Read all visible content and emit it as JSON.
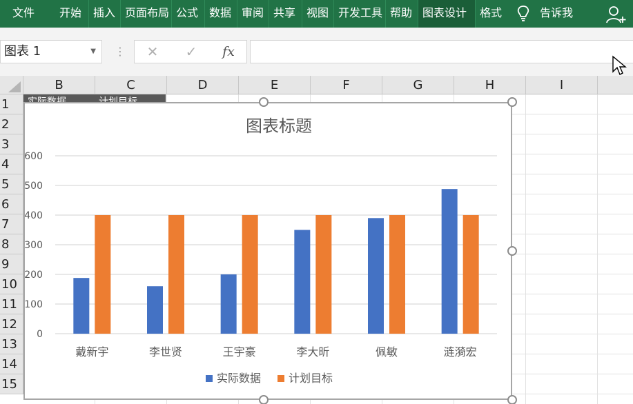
{
  "ribbon": {
    "tabs": [
      {
        "label": "文件",
        "active": false
      },
      {
        "label": "开始",
        "active": false
      },
      {
        "label": "插入",
        "active": false
      },
      {
        "label": "页面布局",
        "active": false
      },
      {
        "label": "公式",
        "active": false
      },
      {
        "label": "数据",
        "active": false
      },
      {
        "label": "审阅",
        "active": false
      },
      {
        "label": "共享",
        "active": false
      },
      {
        "label": "视图",
        "active": false
      },
      {
        "label": "开发工具",
        "active": false
      },
      {
        "label": "帮助",
        "active": false
      },
      {
        "label": "图表设计",
        "active": true
      },
      {
        "label": "格式",
        "active": false
      }
    ],
    "tell_me": "告诉我",
    "share_icon": "person-add-icon",
    "colors": {
      "ribbon": "#217346",
      "active_tab": "#1a5e38"
    }
  },
  "formula_bar": {
    "name_box": "图表 1",
    "cancel_icon": "✕",
    "enter_icon": "✓",
    "fx_label": "fx",
    "formula": ""
  },
  "sheet": {
    "columns": [
      "B",
      "C",
      "D",
      "E",
      "F",
      "G",
      "H",
      "I"
    ],
    "rows": [
      "1",
      "2",
      "3",
      "4",
      "5",
      "6",
      "7",
      "8",
      "9",
      "10",
      "11",
      "12",
      "13",
      "14",
      "15"
    ],
    "header_cells": [
      "实际数据",
      "计划目标"
    ]
  },
  "chart_data": {
    "type": "bar",
    "title": "图表标题",
    "categories": [
      "戴新宇",
      "李世贤",
      "王宇豪",
      "李大昕",
      "佩敏",
      "涟漪宏"
    ],
    "series": [
      {
        "name": "实际数据",
        "values": [
          188,
          160,
          200,
          350,
          390,
          488
        ],
        "color": "#4472c4"
      },
      {
        "name": "计划目标",
        "values": [
          400,
          400,
          400,
          400,
          400,
          400
        ],
        "color": "#ed7d31"
      }
    ],
    "ylim": [
      0,
      600
    ],
    "yticks": [
      0,
      100,
      200,
      300,
      400,
      500,
      600
    ],
    "grid": true,
    "legend": "bottom",
    "xlabel": "",
    "ylabel": ""
  }
}
